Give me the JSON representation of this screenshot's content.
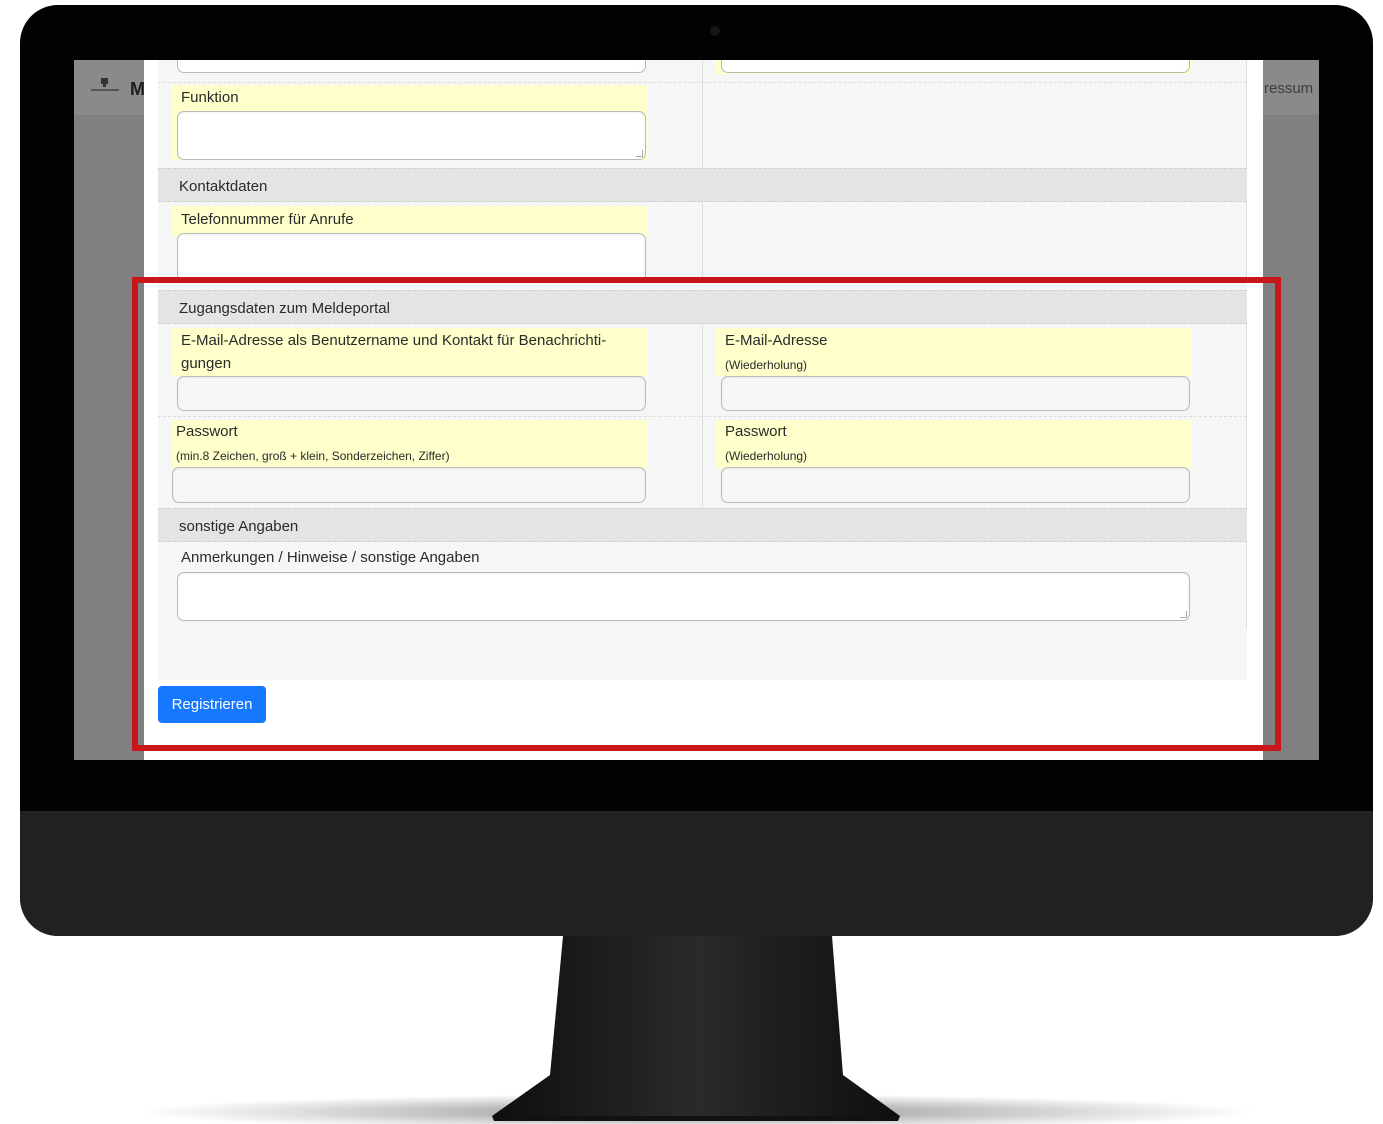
{
  "navbar": {
    "brand_letter": "M",
    "right_link": "ressum"
  },
  "form": {
    "funktion_label": "Funktion",
    "sections": {
      "kontakt": "Kontaktdaten",
      "zugang": "Zugangsdaten zum Meldeportal",
      "sonstige": "sonstige Angaben"
    },
    "telefon_label": "Telefonnummer für Anrufe",
    "email_label_line1": "E-Mail-Adresse als Benutzername und Kontakt für Benachrichti-",
    "email_label_line2": "gungen",
    "email_repeat_label": "E-Mail-Adresse",
    "email_repeat_hint": "(Wiederholung)",
    "password_label": "Passwort",
    "password_hint": "(min.8 Zeichen, groß + klein, Sonderzeichen, Ziffer)",
    "password_repeat_label": "Passwort",
    "password_repeat_hint": "(Wiederholung)",
    "notes_label": "Anmerkungen / Hinweise / sonstige Angaben",
    "submit_label": "Registrieren"
  },
  "colors": {
    "highlight": "#c8161a",
    "button": "#1677ff",
    "label_background": "#ffffcc"
  }
}
